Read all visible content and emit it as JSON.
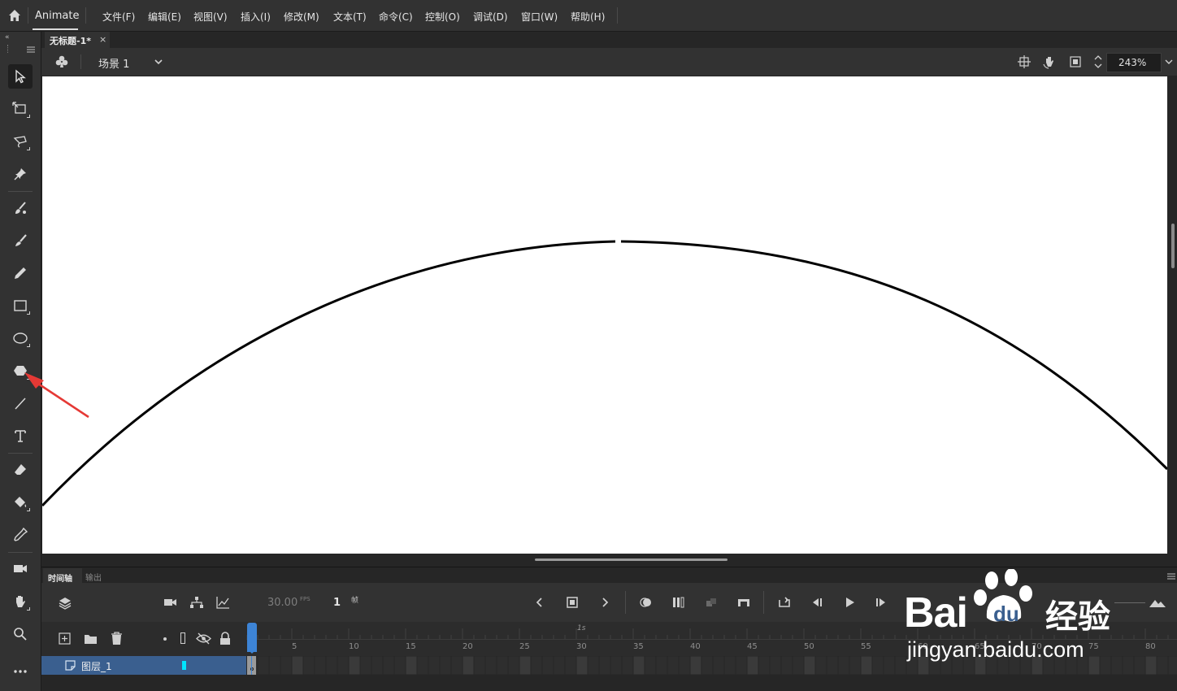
{
  "app": {
    "name": "Animate"
  },
  "menu": [
    "文件(F)",
    "编辑(E)",
    "视图(V)",
    "插入(I)",
    "修改(M)",
    "文本(T)",
    "命令(C)",
    "控制(O)",
    "调试(D)",
    "窗口(W)",
    "帮助(H)"
  ],
  "document": {
    "tab_title": "无标题-1*",
    "close_glyph": "×"
  },
  "scene": {
    "name": "场景 1",
    "zoom": "243%"
  },
  "tools": [
    "selection",
    "free-transform",
    "lasso",
    "pin",
    "fluid-brush",
    "paint-brush",
    "pencil",
    "rectangle",
    "oval",
    "polystar",
    "line",
    "text",
    "eraser",
    "paint-bucket",
    "eyedropper",
    "camera",
    "hand",
    "zoom",
    "more"
  ],
  "timeline": {
    "tab_label": "时间轴",
    "output_tab_label": "输出",
    "fps_value": "30.00",
    "fps_unit": "FPS",
    "current_frame": "1",
    "frame_unit": "帧",
    "seconds_marker": "1s",
    "ruler_numbers": [
      "5",
      "10",
      "15",
      "20",
      "25",
      "30",
      "35",
      "40",
      "45",
      "50",
      "55",
      "60",
      "65",
      "70",
      "75",
      "80"
    ],
    "layer_name": "图层_1"
  },
  "watermark": {
    "brand": "Bai",
    "brand2": "du",
    "site_cn": "经验",
    "url": "jingyan.baidu.com"
  },
  "colors": {
    "accent_blue": "#3a5f8f",
    "layer_color": "#00e5ff",
    "playhead": "#3d84d6",
    "arrow_red": "#e53935"
  }
}
